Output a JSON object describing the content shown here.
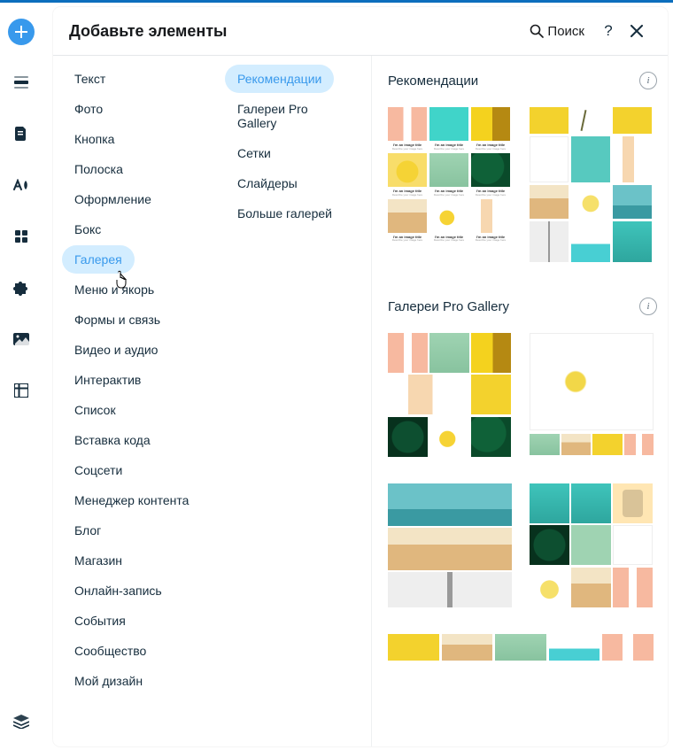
{
  "panel": {
    "title": "Добавьте элементы",
    "search_label": "Поиск"
  },
  "categories": [
    {
      "label": "Текст",
      "selected": false
    },
    {
      "label": "Фото",
      "selected": false
    },
    {
      "label": "Кнопка",
      "selected": false
    },
    {
      "label": "Полоска",
      "selected": false
    },
    {
      "label": "Оформление",
      "selected": false
    },
    {
      "label": "Бокс",
      "selected": false
    },
    {
      "label": "Галерея",
      "selected": true
    },
    {
      "label": "Меню и якорь",
      "selected": false
    },
    {
      "label": "Формы и связь",
      "selected": false
    },
    {
      "label": "Видео и аудио",
      "selected": false
    },
    {
      "label": "Интерактив",
      "selected": false
    },
    {
      "label": "Список",
      "selected": false
    },
    {
      "label": "Вставка кода",
      "selected": false
    },
    {
      "label": "Соцсети",
      "selected": false
    },
    {
      "label": "Менеджер контента",
      "selected": false
    },
    {
      "label": "Блог",
      "selected": false
    },
    {
      "label": "Магазин",
      "selected": false
    },
    {
      "label": "Онлайн-запись",
      "selected": false
    },
    {
      "label": "События",
      "selected": false
    },
    {
      "label": "Сообщество",
      "selected": false
    },
    {
      "label": "Мой дизайн",
      "selected": false
    }
  ],
  "sub": [
    {
      "label": "Рекомендации",
      "selected": true
    },
    {
      "label": "Галереи Pro Gallery",
      "selected": false
    },
    {
      "label": "Сетки",
      "selected": false
    },
    {
      "label": "Слайдеры",
      "selected": false
    },
    {
      "label": "Больше галерей",
      "selected": false
    }
  ],
  "sections": {
    "reco_title": "Рекомендации",
    "pro_title": "Галереи Pro Gallery",
    "caption_title": "I'm an image title",
    "caption_sub": "Describe your image here"
  }
}
